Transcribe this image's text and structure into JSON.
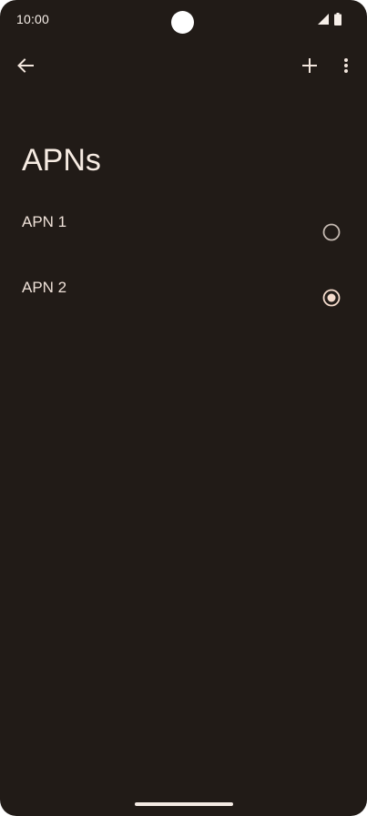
{
  "status_bar": {
    "time": "10:00",
    "signal_icon": "cell-signal-icon",
    "battery_icon": "battery-icon"
  },
  "toolbar": {
    "back_icon": "arrow-back-icon",
    "add_icon": "plus-icon",
    "more_icon": "more-vert-icon"
  },
  "page": {
    "title": "APNs"
  },
  "apns": [
    {
      "label": "APN 1",
      "selected": false
    },
    {
      "label": "APN 2",
      "selected": true
    }
  ],
  "colors": {
    "background": "#211b17",
    "text": "#f1e4da",
    "radio_accent": "#f5dccd",
    "radio_unchecked": "#c5bab2"
  }
}
